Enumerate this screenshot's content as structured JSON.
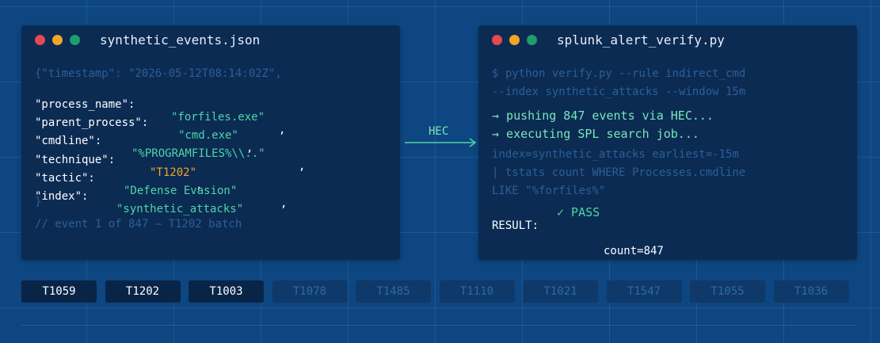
{
  "left_window": {
    "title": "synthetic_events.json",
    "lines": {
      "open": "{\"timestamp\": \"2026-05-12T08:14:02Z\",",
      "process_name_key": "\"process_name\":",
      "process_name_val": "\"forfiles.exe\"",
      "process_name_end": ",",
      "parent_process_key": "\"parent_process\":",
      "parent_process_val": "\"cmd.exe\"",
      "parent_process_end": ",",
      "cmdline_key": "\"cmdline\":",
      "cmdline_val": "\"%PROGRAMFILES%\\\\..\"",
      "cmdline_end": ",",
      "technique_key": "\"technique\":",
      "technique_val": "\"T1202\"",
      "technique_end": ",",
      "tactic_key": "\"tactic\":",
      "tactic_val": "\"Defense Evasion\"",
      "tactic_end": ",",
      "index_key": "\"index\":",
      "index_val": "\"synthetic_attacks\"",
      "close": "}",
      "comment": "// event 1 of 847 — T1202 batch"
    }
  },
  "connector": {
    "label": "HEC"
  },
  "right_window": {
    "title": "splunk_alert_verify.py",
    "lines": {
      "cmd1": "$ python verify.py --rule indirect_cmd",
      "cmd2": "--index synthetic_attacks --window 15m",
      "step1": "→ pushing 847 events via HEC...",
      "step2": "→ executing SPL search job...",
      "spl1": "index=synthetic_attacks earliest=-15m",
      "spl2": "| tstats count WHERE Processes.cmdline",
      "spl3": "LIKE \"%forfiles%\"",
      "result_label": "RESULT:",
      "result_status": "✓ PASS",
      "result_count": "count=847"
    }
  },
  "technique_tags": [
    {
      "label": "T1059",
      "active": true
    },
    {
      "label": "T1202",
      "active": true
    },
    {
      "label": "T1003",
      "active": true
    },
    {
      "label": "T1078",
      "active": false
    },
    {
      "label": "T1485",
      "active": false
    },
    {
      "label": "T1110",
      "active": false
    },
    {
      "label": "T1021",
      "active": false
    },
    {
      "label": "T1547",
      "active": false
    },
    {
      "label": "T1055",
      "active": false
    },
    {
      "label": "T1036",
      "active": false
    }
  ],
  "colors": {
    "background": "#0d4680",
    "window": "#0b2b53",
    "string": "#4fd4a8",
    "accent": "#f5a524",
    "dim": "#2b5f98",
    "dot_red": "#e5484d",
    "dot_yellow": "#f5a524",
    "dot_green": "#1f9d6b"
  }
}
